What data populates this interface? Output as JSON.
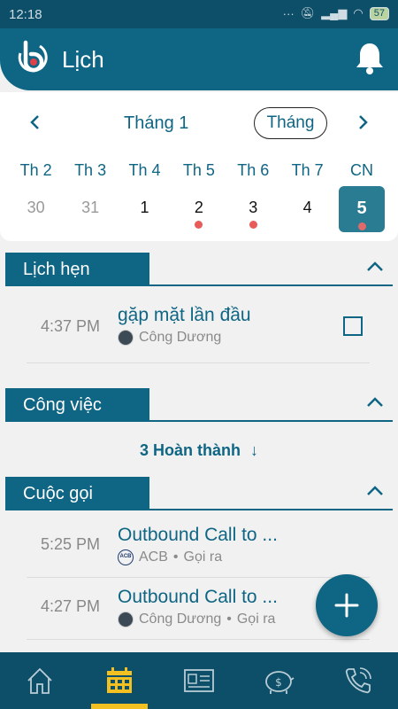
{
  "status_bar": {
    "time": "12:18",
    "battery": "57"
  },
  "header": {
    "title": "Lịch"
  },
  "calendar": {
    "month_label": "Tháng 1",
    "view_toggle": "Tháng",
    "weekdays": [
      "Th 2",
      "Th 3",
      "Th 4",
      "Th 5",
      "Th 6",
      "Th 7",
      "CN"
    ],
    "days": [
      {
        "label": "30",
        "muted": true,
        "has_event": false,
        "selected": false
      },
      {
        "label": "31",
        "muted": true,
        "has_event": false,
        "selected": false
      },
      {
        "label": "1",
        "muted": false,
        "has_event": false,
        "selected": false
      },
      {
        "label": "2",
        "muted": false,
        "has_event": true,
        "selected": false
      },
      {
        "label": "3",
        "muted": false,
        "has_event": true,
        "selected": false
      },
      {
        "label": "4",
        "muted": false,
        "has_event": false,
        "selected": false
      },
      {
        "label": "5",
        "muted": false,
        "has_event": true,
        "selected": true
      }
    ]
  },
  "appointments": {
    "title": "Lịch hẹn",
    "items": [
      {
        "time": "4:37 PM",
        "title": "gặp mặt lần đầu",
        "contact": "Công Dương"
      }
    ]
  },
  "tasks": {
    "title": "Công việc",
    "completed_label": "3 Hoàn thành",
    "completed_arrow": "↓"
  },
  "calls": {
    "title": "Cuộc gọi",
    "items": [
      {
        "time": "5:25 PM",
        "title": "Outbound Call to ...",
        "contact": "ACB",
        "type": "Gọi ra"
      },
      {
        "time": "4:27 PM",
        "title": "Outbound Call to ...",
        "contact": "Công Dương",
        "type": "Gọi ra"
      }
    ]
  },
  "colors": {
    "primary": "#0f6584",
    "dark": "#0d4e68",
    "accent": "#f3c021",
    "event_dot": "#e85b5b"
  },
  "icons": {
    "nav": [
      "home-icon",
      "calendar-icon",
      "contact-card-icon",
      "piggy-bank-icon",
      "phone-call-icon"
    ],
    "fab": "plus-icon"
  }
}
